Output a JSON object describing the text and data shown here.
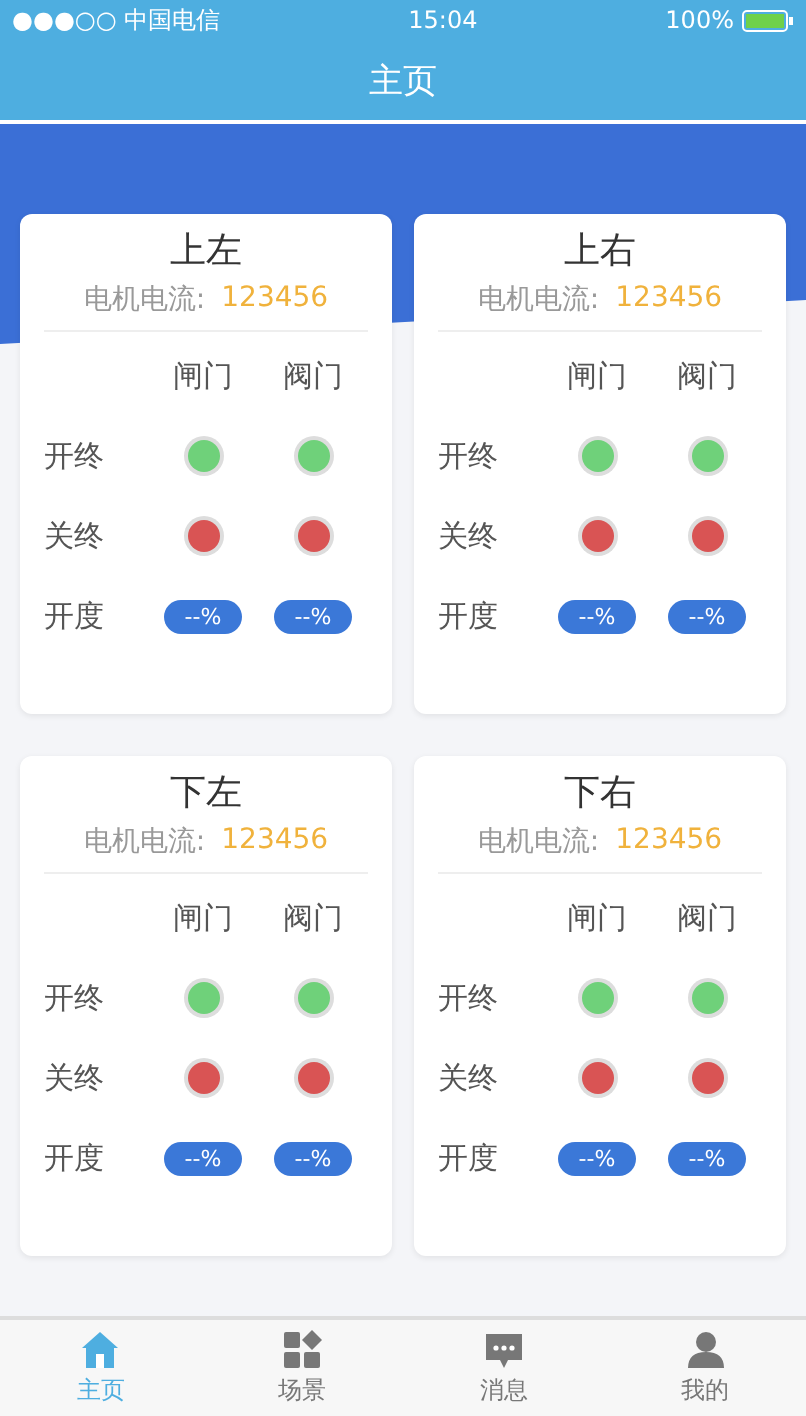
{
  "status_bar": {
    "carrier": "●●●○○ 中国电信",
    "time": "15:04",
    "battery": "100%"
  },
  "nav": {
    "title": "主页"
  },
  "cards": [
    {
      "title": "上左",
      "current_label": "电机电流:",
      "current_value": "123456",
      "columns": [
        "闸门",
        "阀门"
      ],
      "rows": [
        {
          "label": "开终",
          "kind": "lamp",
          "cells": [
            {
              "color": "#6fd17a"
            },
            {
              "color": "#6fd17a"
            }
          ]
        },
        {
          "label": "关终",
          "kind": "lamp",
          "cells": [
            {
              "color": "#d95454"
            },
            {
              "color": "#d95454"
            }
          ]
        },
        {
          "label": "开度",
          "kind": "pill",
          "cells": [
            {
              "text": "--%"
            },
            {
              "text": "--%"
            }
          ]
        }
      ]
    },
    {
      "title": "上右",
      "current_label": "电机电流:",
      "current_value": "123456",
      "columns": [
        "闸门",
        "阀门"
      ],
      "rows": [
        {
          "label": "开终",
          "kind": "lamp",
          "cells": [
            {
              "color": "#6fd17a"
            },
            {
              "color": "#6fd17a"
            }
          ]
        },
        {
          "label": "关终",
          "kind": "lamp",
          "cells": [
            {
              "color": "#d95454"
            },
            {
              "color": "#d95454"
            }
          ]
        },
        {
          "label": "开度",
          "kind": "pill",
          "cells": [
            {
              "text": "--%"
            },
            {
              "text": "--%"
            }
          ]
        }
      ]
    },
    {
      "title": "下左",
      "current_label": "电机电流:",
      "current_value": "123456",
      "columns": [
        "闸门",
        "阀门"
      ],
      "rows": [
        {
          "label": "开终",
          "kind": "lamp",
          "cells": [
            {
              "color": "#6fd17a"
            },
            {
              "color": "#6fd17a"
            }
          ]
        },
        {
          "label": "关终",
          "kind": "lamp",
          "cells": [
            {
              "color": "#d95454"
            },
            {
              "color": "#d95454"
            }
          ]
        },
        {
          "label": "开度",
          "kind": "pill",
          "cells": [
            {
              "text": "--%"
            },
            {
              "text": "--%"
            }
          ]
        }
      ]
    },
    {
      "title": "下右",
      "current_label": "电机电流:",
      "current_value": "123456",
      "columns": [
        "闸门",
        "阀门"
      ],
      "rows": [
        {
          "label": "开终",
          "kind": "lamp",
          "cells": [
            {
              "color": "#6fd17a"
            },
            {
              "color": "#6fd17a"
            }
          ]
        },
        {
          "label": "关终",
          "kind": "lamp",
          "cells": [
            {
              "color": "#d95454"
            },
            {
              "color": "#d95454"
            }
          ]
        },
        {
          "label": "开度",
          "kind": "pill",
          "cells": [
            {
              "text": "--%"
            },
            {
              "text": "--%"
            }
          ]
        }
      ]
    }
  ],
  "tabs": [
    {
      "label": "主页",
      "kind": "home",
      "selected": true
    },
    {
      "label": "场景",
      "kind": "grid",
      "selected": false
    },
    {
      "label": "消息",
      "kind": "chat",
      "selected": false
    },
    {
      "label": "我的",
      "kind": "person",
      "selected": false
    }
  ]
}
